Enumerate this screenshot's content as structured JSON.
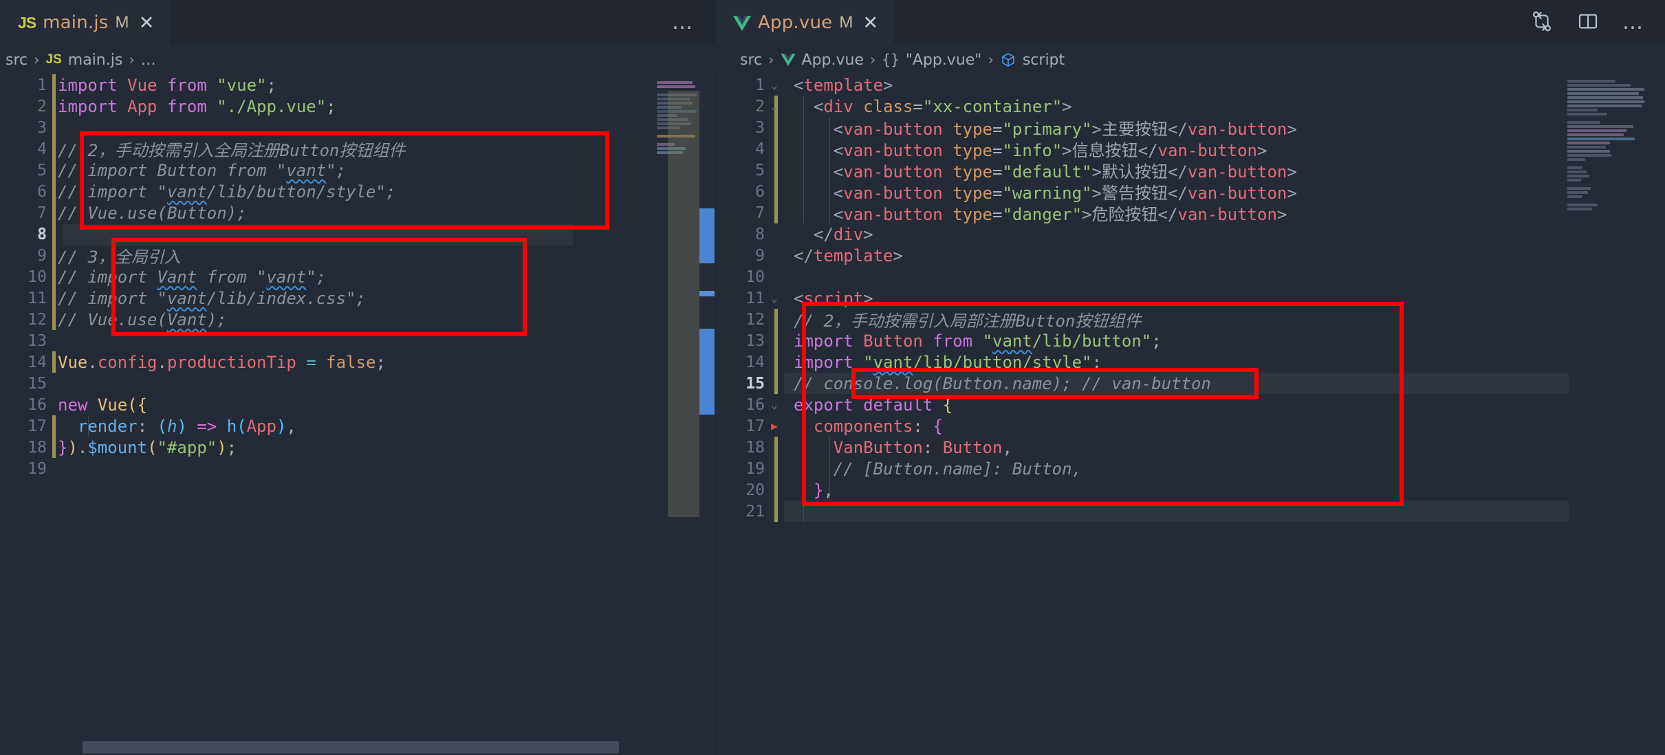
{
  "window": {
    "toolbar_icons": [
      "compare-changes-icon",
      "split-editor-icon",
      "more-actions-icon"
    ],
    "more_label": "…"
  },
  "left_pane": {
    "tab": {
      "icon": "js-file-icon",
      "icon_label": "JS",
      "filename": "main.js",
      "modified_badge": "M",
      "close_label": "✕"
    },
    "overflow_label": "…",
    "breadcrumb": [
      {
        "label": "src",
        "icon": ""
      },
      {
        "label": "main.js",
        "icon": "js-file-icon",
        "icon_label": "JS"
      },
      {
        "label": "…",
        "icon": ""
      }
    ],
    "breadcrumb_sep": "›",
    "active_line": 8,
    "lines": [
      {
        "n": 1,
        "git": true,
        "text": "import Vue from \"vue\";"
      },
      {
        "n": 2,
        "git": true,
        "text": "import App from \"./App.vue\";"
      },
      {
        "n": 3,
        "git": true,
        "text": ""
      },
      {
        "n": 4,
        "git": true,
        "text": "// 2, 手动按需引入全局注册Button按钮组件"
      },
      {
        "n": 5,
        "git": true,
        "text": "// import Button from \"vant\";"
      },
      {
        "n": 6,
        "git": true,
        "text": "// import \"vant/lib/button/style\";"
      },
      {
        "n": 7,
        "git": true,
        "text": "// Vue.use(Button);"
      },
      {
        "n": 8,
        "git": true,
        "text": ""
      },
      {
        "n": 9,
        "git": true,
        "text": "// 3, 全局引入"
      },
      {
        "n": 10,
        "git": true,
        "text": "// import Vant from \"vant\";"
      },
      {
        "n": 11,
        "git": true,
        "text": "// import \"vant/lib/index.css\";"
      },
      {
        "n": 12,
        "git": true,
        "text": "// Vue.use(Vant);"
      },
      {
        "n": 13,
        "git": false,
        "text": ""
      },
      {
        "n": 14,
        "git": true,
        "text": "Vue.config.productionTip = false;"
      },
      {
        "n": 15,
        "git": false,
        "text": ""
      },
      {
        "n": 16,
        "git": false,
        "text": "new Vue({"
      },
      {
        "n": 17,
        "git": true,
        "text": "  render: (h) => h(App),"
      },
      {
        "n": 18,
        "git": true,
        "text": "}).$mount(\"#app\");"
      },
      {
        "n": 19,
        "git": false,
        "text": ""
      }
    ]
  },
  "right_pane": {
    "tab": {
      "icon": "vue-file-icon",
      "filename": "App.vue",
      "modified_badge": "M",
      "close_label": "✕"
    },
    "breadcrumb": [
      {
        "label": "src",
        "icon": ""
      },
      {
        "label": "App.vue",
        "icon": "vue-file-icon"
      },
      {
        "label": "\"App.vue\"",
        "icon": "braces-icon",
        "icon_label": "{}"
      },
      {
        "label": "script",
        "icon": "symbol-module-icon"
      }
    ],
    "breadcrumb_sep": "›",
    "active_line": 15,
    "lines": [
      {
        "n": 1,
        "git": false,
        "fold": "v",
        "text": "<template>"
      },
      {
        "n": 2,
        "git": true,
        "fold": "v",
        "text": "  <div class=\"xx-container\">"
      },
      {
        "n": 3,
        "git": true,
        "fold": "",
        "text": "    <van-button type=\"primary\">主要按钮</van-button>"
      },
      {
        "n": 4,
        "git": true,
        "fold": "",
        "text": "    <van-button type=\"info\">信息按钮</van-button>"
      },
      {
        "n": 5,
        "git": true,
        "fold": "",
        "text": "    <van-button type=\"default\">默认按钮</van-button>"
      },
      {
        "n": 6,
        "git": true,
        "fold": "",
        "text": "    <van-button type=\"warning\">警告按钮</van-button>"
      },
      {
        "n": 7,
        "git": true,
        "fold": "",
        "text": "    <van-button type=\"danger\">危险按钮</van-button>"
      },
      {
        "n": 8,
        "git": false,
        "fold": "",
        "text": "  </div>"
      },
      {
        "n": 9,
        "git": false,
        "fold": "",
        "text": "</template>"
      },
      {
        "n": 10,
        "git": false,
        "fold": "",
        "text": ""
      },
      {
        "n": 11,
        "git": false,
        "fold": "v",
        "text": "<script>"
      },
      {
        "n": 12,
        "git": true,
        "fold": "",
        "text": "// 2, 手动按需引入局部注册Button按钮组件"
      },
      {
        "n": 13,
        "git": true,
        "fold": "",
        "text": "import Button from \"vant/lib/button\";"
      },
      {
        "n": 14,
        "git": true,
        "fold": "",
        "text": "import \"vant/lib/button/style\";"
      },
      {
        "n": 15,
        "git": true,
        "fold": "",
        "text": "// console.log(Button.name); // van-button"
      },
      {
        "n": 16,
        "git": false,
        "fold": "v",
        "text": "export default {"
      },
      {
        "n": 17,
        "git": false,
        "fold": "v",
        "text": "  components: {"
      },
      {
        "n": 18,
        "git": true,
        "fold": "",
        "text": "    VanButton: Button,"
      },
      {
        "n": 19,
        "git": true,
        "fold": "",
        "text": "    // [Button.name]: Button,"
      },
      {
        "n": 20,
        "git": true,
        "fold": "",
        "text": "  },"
      },
      {
        "n": 21,
        "git": true,
        "fold": "",
        "text": ""
      }
    ]
  },
  "colors": {
    "editor_bg": "#252b36",
    "tabbar_bg": "#22262f",
    "active_tab_bg": "#262c37",
    "active_line_bg": "#2e3440",
    "annotation_red": "#ff0000",
    "git_modified": "#9c9354",
    "vue_green": "#41b883",
    "js_yellow": "#cbcb41"
  },
  "annotations": [
    {
      "name": "left-redbox-global-register",
      "pane": "left"
    },
    {
      "name": "left-redbox-global-import",
      "pane": "left"
    },
    {
      "name": "right-redbox-script-block",
      "pane": "right"
    },
    {
      "name": "right-redbox-console-log",
      "pane": "right"
    }
  ]
}
